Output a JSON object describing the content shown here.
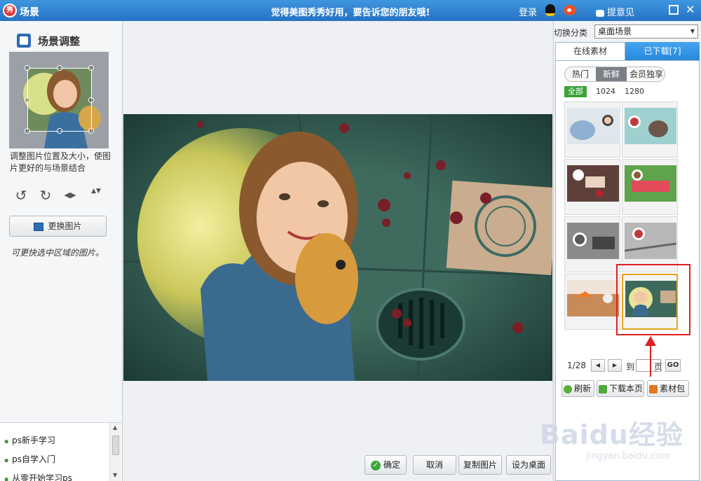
{
  "titlebar": {
    "app_icon_text": "秀",
    "title": "场景",
    "slogan": "觉得美图秀秀好用，要告诉您的朋友哦!",
    "login": "登录",
    "feedback": "提意见",
    "close": "✕",
    "accent": "#2f80d0"
  },
  "left_panel": {
    "title": "场景调整",
    "hint": "调整图片位置及大小，使图片更好的与场景结合",
    "tools": [
      "rotate-left-icon",
      "rotate-right-icon",
      "flip-horizontal-icon",
      "flip-vertical-icon"
    ],
    "tool_glyphs": [
      "↺",
      "↻",
      "◀▶",
      "▲▼"
    ],
    "replace_button": "更换图片",
    "quick_hint": "可更快选中区域的图片。",
    "ad_list": [
      "ps新手学习",
      "ps自学入门",
      "从零开始学习ps"
    ]
  },
  "actions": {
    "ok": "确定",
    "cancel": "取消",
    "copy": "复制图片",
    "set_wallpaper": "设为桌面"
  },
  "right_panel": {
    "category_label": "切换分类",
    "category_value": "桌面场景",
    "tabs": {
      "online": "在线素材",
      "downloaded": "已下载[7]"
    },
    "filters": [
      "热门",
      "新鲜",
      "会员独享"
    ],
    "filter_selected": "新鲜",
    "resolutions": [
      "全部",
      "1024",
      "1280"
    ],
    "resolution_selected": "全部",
    "thumb_count": 8,
    "selected_thumb_index": 8,
    "pager": {
      "indicator": "1/28",
      "prev": "◀",
      "next": "▶",
      "goto_label": "到",
      "page_suffix": "页",
      "go": "GO"
    },
    "tools": [
      "刷新",
      "下载本页",
      "素材包"
    ]
  },
  "annotation_color": "#e02020",
  "watermark": {
    "logo": "Baidu经验",
    "url": "jingyan.baidu.com"
  }
}
